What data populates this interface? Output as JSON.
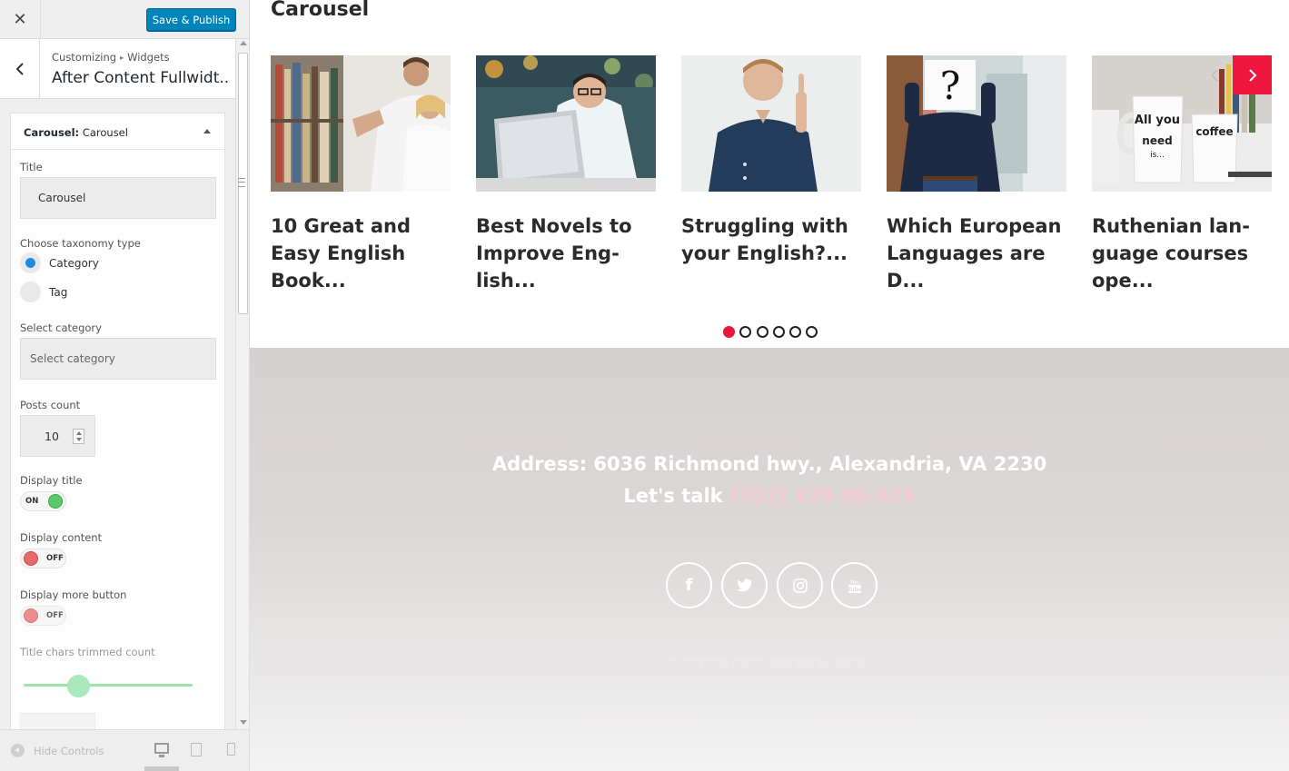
{
  "header": {
    "close_icon": "close-icon",
    "publish_label": "Save & Publish"
  },
  "section": {
    "breadcrumb_root": "Customizing",
    "breadcrumb_child": "Widgets",
    "title": "After Content Fullwidt..."
  },
  "widget": {
    "type": "Carousel:",
    "name": "Carousel",
    "title_label": "Title",
    "title_value": "Carousel",
    "taxonomy_label": "Choose taxonomy type",
    "taxonomy_options": [
      "Category",
      "Tag"
    ],
    "taxonomy_selected": "Category",
    "category_label": "Select category",
    "category_placeholder": "Select category",
    "posts_count_label": "Posts count",
    "posts_count_value": "10",
    "display_title_label": "Display title",
    "display_title_state": "ON",
    "display_content_label": "Display content",
    "display_content_state": "OFF",
    "display_more_label": "Display more button",
    "display_more_state": "OFF",
    "title_trim_label": "Title chars trimmed count"
  },
  "footer_controls": {
    "hide_label": "Hide Controls",
    "active_device": "desktop"
  },
  "preview": {
    "carousel_heading": "Carousel",
    "posts": [
      {
        "title": "10 Great and Easy English Book...",
        "image": "library-students"
      },
      {
        "title": "Best Novels to Improve Eng-lish...",
        "image": "man-laptop"
      },
      {
        "title": "Struggling with your English?...",
        "image": "man-thinking"
      },
      {
        "title": "Which European Languages are D...",
        "image": "question-mark-man"
      },
      {
        "title": "Ruthenian lan-guage courses ope...",
        "image": "coffee-mugs"
      }
    ],
    "active_dot": 1,
    "dot_count": 6,
    "accent_color": "#f0173f",
    "footer": {
      "address": "Address: 6036 Richmond hwy., Alexandria, VA 2230",
      "talk_label": "Let's talk",
      "phone": "(703) 329-06-325",
      "social": [
        "facebook-icon",
        "twitter-icon",
        "instagram-icon",
        "youtube-icon"
      ],
      "copyright": "© 2017 All rights reserved by spello."
    }
  }
}
